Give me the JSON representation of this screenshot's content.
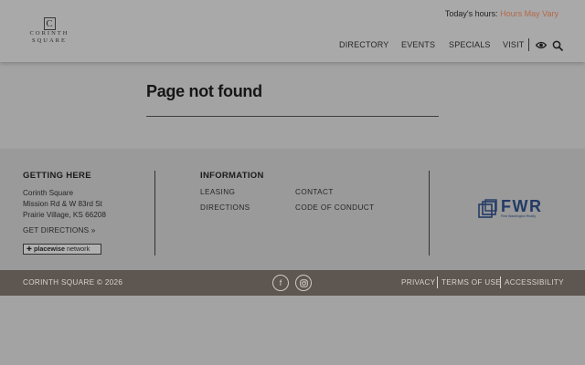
{
  "header": {
    "logo": {
      "initial": "C",
      "word1": "CORINTH",
      "word2": "SQUARE"
    },
    "hours_label": "Today's hours:",
    "hours_value": "Hours May Vary",
    "nav": [
      "DIRECTORY",
      "EVENTS",
      "SPECIALS",
      "VISIT"
    ],
    "icons": [
      "eye-icon",
      "search-icon"
    ]
  },
  "main": {
    "title": "Page not found"
  },
  "footer": {
    "getting_here": {
      "heading": "GETTING HERE",
      "address_lines": [
        "Corinth Square",
        "Mission Rd & W 83rd St",
        "Prairie Village, KS 66208"
      ],
      "directions_link": "GET DIRECTIONS »",
      "badge_brand": "placewise",
      "badge_suffix": "network"
    },
    "information": {
      "heading": "INFORMATION",
      "links": [
        "LEASING",
        "CONTACT",
        "DIRECTIONS",
        "CODE OF CONDUCT"
      ]
    },
    "partner_logo": {
      "text": "FWR",
      "sub": "First Washington Realty"
    }
  },
  "bottom": {
    "copyright": "CORINTH SQUARE © 2026",
    "social": [
      "facebook-icon",
      "instagram-icon"
    ],
    "legal_links": [
      "PRIVACY",
      "TERMS OF USE",
      "ACCESSIBILITY"
    ]
  },
  "colors": {
    "accent": "#b5694a",
    "bottom_bar": "#5d5651",
    "fwr_blue": "#233a66"
  }
}
